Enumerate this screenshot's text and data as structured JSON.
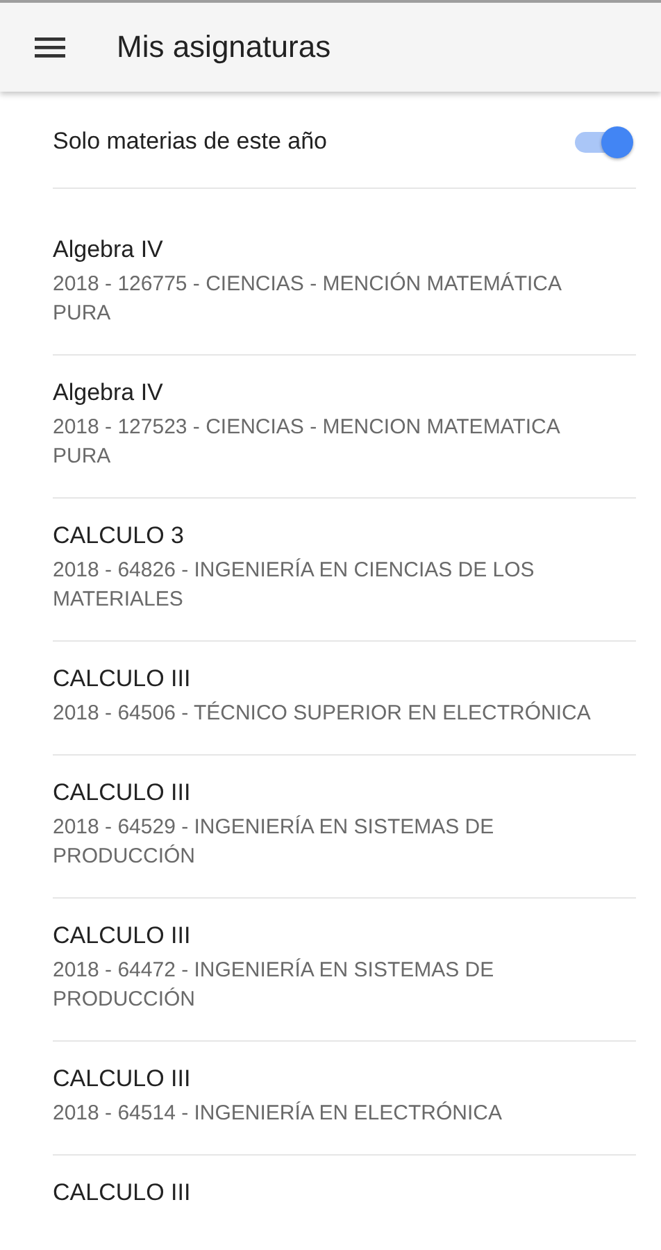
{
  "app_bar": {
    "title": "Mis asignaturas"
  },
  "filter": {
    "label": "Solo materias de este año",
    "on": true
  },
  "subjects": [
    {
      "title": "Algebra IV",
      "subtitle": "2018 - 126775 - CIENCIAS - MENCIÓN MATEMÁTICA PURA"
    },
    {
      "title": "Algebra IV",
      "subtitle": "2018 - 127523 - CIENCIAS - MENCION MATEMATICA PURA"
    },
    {
      "title": "CALCULO 3",
      "subtitle": "2018 - 64826 - INGENIERÍA EN CIENCIAS DE LOS MATERIALES"
    },
    {
      "title": "CALCULO III",
      "subtitle": "2018 - 64506 - TÉCNICO SUPERIOR EN ELECTRÓNICA"
    },
    {
      "title": "CALCULO III",
      "subtitle": "2018 - 64529 - INGENIERÍA EN SISTEMAS DE PRODUCCIÓN"
    },
    {
      "title": "CALCULO III",
      "subtitle": "2018 - 64472 - INGENIERÍA EN SISTEMAS DE PRODUCCIÓN"
    },
    {
      "title": "CALCULO III",
      "subtitle": "2018 - 64514 - INGENIERÍA EN ELECTRÓNICA"
    },
    {
      "title": "CALCULO III"
    }
  ]
}
